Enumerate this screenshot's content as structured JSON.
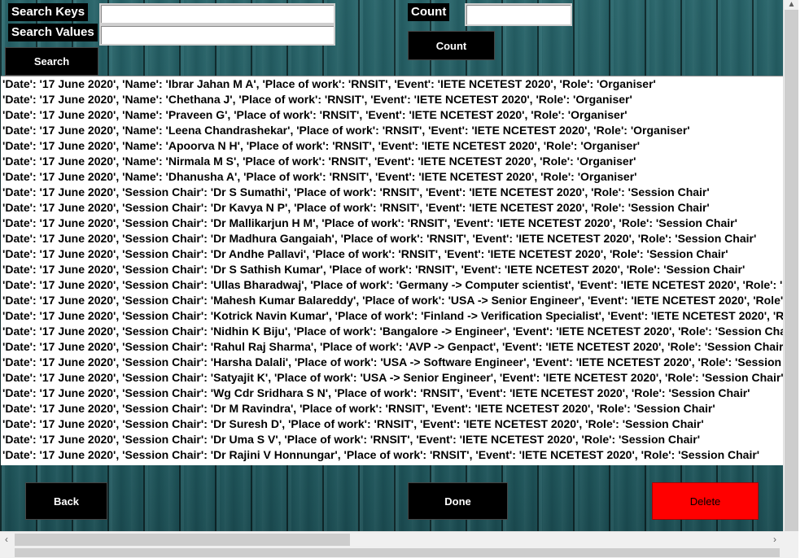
{
  "search": {
    "keys_label": "Search Keys",
    "values_label": "Search Values",
    "keys_value": "",
    "values_value": "",
    "search_button": "Search"
  },
  "count": {
    "label": "Count",
    "value": "",
    "button": "Count"
  },
  "actions": {
    "back": "Back",
    "done": "Done",
    "delete": "Delete"
  },
  "results": [
    "'Date': '17 June 2020', 'Name': 'Ibrar Jahan M A', 'Place of work': 'RNSIT', 'Event': 'IETE NCETEST 2020', 'Role': 'Organiser'",
    "'Date': '17 June 2020', 'Name': 'Chethana J', 'Place of work': 'RNSIT', 'Event': 'IETE NCETEST 2020', 'Role': 'Organiser'",
    "'Date': '17 June 2020', 'Name': 'Praveen G', 'Place of work': 'RNSIT', 'Event': 'IETE NCETEST 2020', 'Role': 'Organiser'",
    "'Date': '17 June 2020', 'Name': 'Leena Chandrashekar', 'Place of work': 'RNSIT', 'Event': 'IETE NCETEST 2020', 'Role': 'Organiser'",
    "'Date': '17 June 2020', 'Name': 'Apoorva N H', 'Place of work': 'RNSIT', 'Event': 'IETE NCETEST 2020', 'Role': 'Organiser'",
    "'Date': '17 June 2020', 'Name': 'Nirmala M S', 'Place of work': 'RNSIT', 'Event': 'IETE NCETEST 2020', 'Role': 'Organiser'",
    "'Date': '17 June 2020', 'Name': 'Dhanusha A', 'Place of work': 'RNSIT', 'Event': 'IETE NCETEST 2020', 'Role': 'Organiser'",
    "'Date': '17 June 2020', 'Session Chair': 'Dr S Sumathi', 'Place of work': 'RNSIT', 'Event': 'IETE NCETEST 2020', 'Role': 'Session Chair'",
    "'Date': '17 June 2020', 'Session Chair': 'Dr Kavya N P', 'Place of work': 'RNSIT', 'Event': 'IETE NCETEST 2020', 'Role': 'Session Chair'",
    "'Date': '17 June 2020', 'Session Chair': 'Dr Mallikarjun H M', 'Place of work': 'RNSIT', 'Event': 'IETE NCETEST 2020', 'Role': 'Session Chair'",
    "'Date': '17 June 2020', 'Session Chair': 'Dr Madhura Gangaiah', 'Place of work': 'RNSIT', 'Event': 'IETE NCETEST 2020', 'Role': 'Session Chair'",
    "'Date': '17 June 2020', 'Session Chair': 'Dr Andhe Pallavi', 'Place of work': 'RNSIT', 'Event': 'IETE NCETEST 2020', 'Role': 'Session Chair'",
    "'Date': '17 June 2020', 'Session Chair': 'Dr S Sathish  Kumar', 'Place of work': 'RNSIT', 'Event': 'IETE NCETEST 2020', 'Role': 'Session Chair'",
    "'Date': '17 June 2020', 'Session Chair': 'Ullas Bharadwaj', 'Place of work': 'Germany -> Computer scientist', 'Event': 'IETE NCETEST 2020', 'Role': 'Session Chair'",
    "'Date': '17 June 2020', 'Session Chair': 'Mahesh Kumar Balareddy', 'Place of work': 'USA -> Senior Engineer', 'Event': 'IETE NCETEST 2020', 'Role': 'Session Chair'",
    "'Date': '17 June 2020', 'Session Chair': 'Kotrick Navin Kumar', 'Place of work': 'Finland -> Verification Specialist', 'Event': 'IETE NCETEST 2020', 'Role': 'Session Chair'",
    "'Date': '17 June 2020', 'Session Chair': 'Nidhin K Biju', 'Place of work': 'Bangalore -> Engineer', 'Event': 'IETE NCETEST 2020', 'Role': 'Session Chair'",
    "'Date': '17 June 2020', 'Session Chair': 'Rahul Raj Sharma', 'Place of work': 'AVP -> Genpact', 'Event': 'IETE NCETEST 2020', 'Role': 'Session Chair'",
    "'Date': '17 June 2020', 'Session Chair': 'Harsha Dalali', 'Place of work': 'USA -> Software Engineer', 'Event': 'IETE NCETEST 2020', 'Role': 'Session Chair'",
    "'Date': '17 June 2020', 'Session Chair': 'Satyajit K', 'Place of work': 'USA -> Senior Engineer', 'Event': 'IETE NCETEST 2020', 'Role': 'Session Chair'",
    "'Date': '17 June 2020', 'Session Chair': 'Wg Cdr Sridhara S N', 'Place of work': 'RNSIT', 'Event': 'IETE NCETEST 2020', 'Role': 'Session Chair'",
    "'Date': '17 June 2020', 'Session Chair': 'Dr M Ravindra', 'Place of work': 'RNSIT', 'Event': 'IETE NCETEST 2020', 'Role': 'Session Chair'",
    "'Date': '17 June 2020', 'Session Chair': 'Dr Suresh D', 'Place of work': 'RNSIT', 'Event': 'IETE NCETEST 2020', 'Role': 'Session Chair'",
    "'Date': '17 June 2020', 'Session Chair': 'Dr Uma S V', 'Place of work': 'RNSIT', 'Event': 'IETE NCETEST 2020', 'Role': 'Session Chair'",
    "'Date': '17 June 2020', 'Session Chair': 'Dr Rajini V Honnungar', 'Place of work': 'RNSIT', 'Event': 'IETE NCETEST 2020', 'Role': 'Session Chair'"
  ],
  "scroll_icons": {
    "up": "chevron-up-icon",
    "down": "chevron-down-icon",
    "left": "chevron-left-icon",
    "right": "chevron-right-icon"
  },
  "colors": {
    "delete_bg": "#ff0000",
    "button_bg": "#000000",
    "background_teal": "#1f5a60"
  }
}
